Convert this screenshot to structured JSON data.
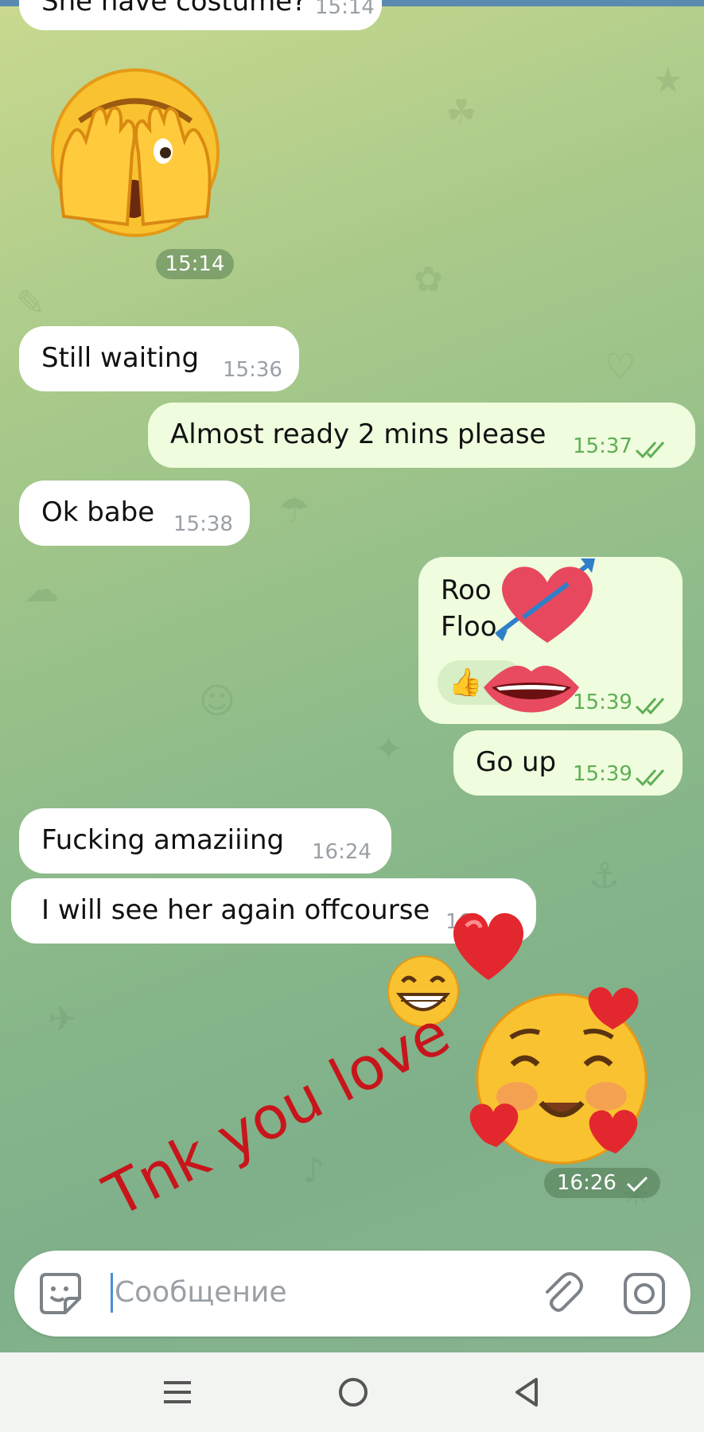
{
  "messages": [
    {
      "text": "She have costume?",
      "time": "15:14"
    },
    {
      "text": "Still waiting",
      "time": "15:36"
    },
    {
      "text": "Almost ready 2 mins please",
      "time": "15:37"
    },
    {
      "text": "Ok babe",
      "time": "15:38"
    },
    {
      "text_line1": "Roo",
      "text_line2": "Floo",
      "reaction": "👍",
      "time": "15:39"
    },
    {
      "text": "Go up",
      "time": "15:39"
    },
    {
      "text": "Fucking amaziiing",
      "time": "16:24"
    },
    {
      "text": "I will see her again offcourse",
      "time": "16"
    }
  ],
  "stickers": {
    "see_no_evil_time": "15:14",
    "blush_time": "16:26"
  },
  "overlay": {
    "handwritten": "Tnk you love"
  },
  "input": {
    "placeholder": "Сообщение"
  },
  "colors": {
    "incoming_bubble": "#ffffff",
    "outgoing_bubble": "#effdde",
    "read_tick": "#5fae55",
    "handwriting": "#c8151b"
  },
  "icons": [
    "sticker-icon",
    "attach-icon",
    "camera-icon",
    "menu-icon",
    "home-icon",
    "back-icon"
  ]
}
